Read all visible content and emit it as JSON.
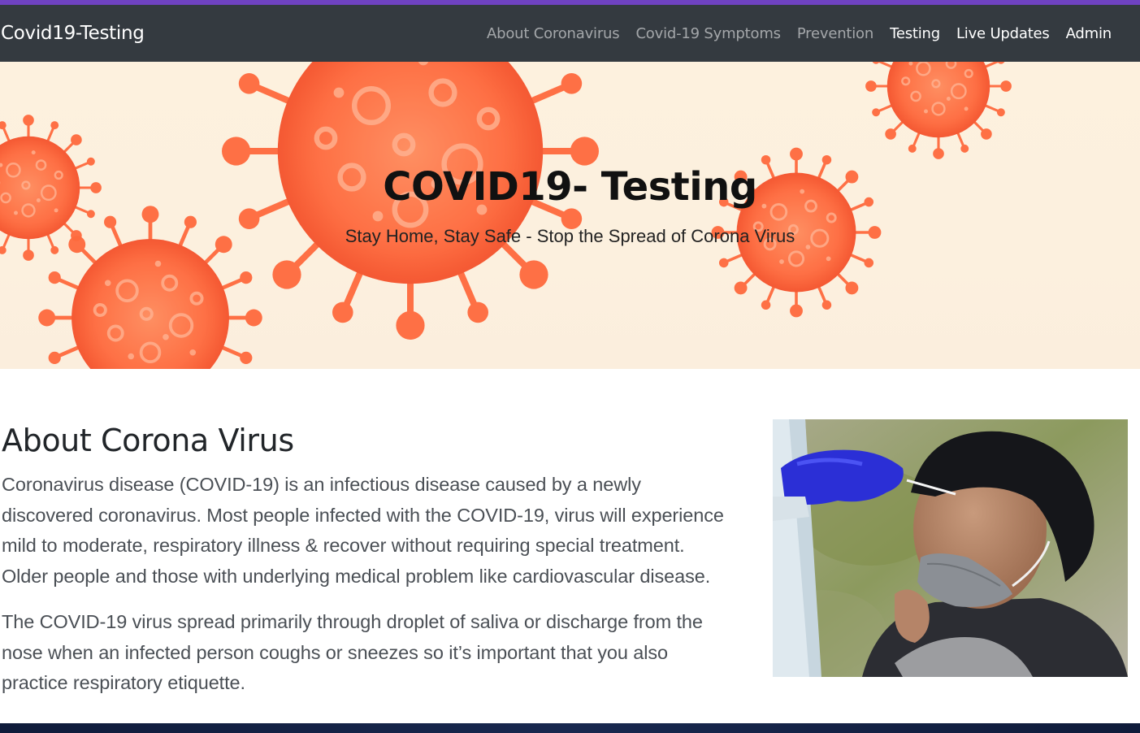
{
  "colors": {
    "top_stripe": "#6f42c1",
    "navbar_bg": "#343a40",
    "nav_inactive": "rgba(255,255,255,0.55)",
    "nav_active": "#ffffff",
    "hero_bg": "#fcf0de",
    "virus_orange": "#ff6a3d",
    "footer_bg": "#132245"
  },
  "navbar": {
    "brand": "Covid19-Testing",
    "items": [
      {
        "label": "About Coronavirus",
        "active": false
      },
      {
        "label": "Covid-19 Symptoms",
        "active": false
      },
      {
        "label": "Prevention",
        "active": false
      },
      {
        "label": "Testing",
        "active": true
      },
      {
        "label": "Live Updates",
        "active": true
      },
      {
        "label": "Admin",
        "active": true
      }
    ]
  },
  "hero": {
    "title": "COVID19- Testing",
    "subtitle": "Stay Home, Stay Safe - Stop the Spread of Corona Virus"
  },
  "about": {
    "heading": "About Corona Virus",
    "paragraphs": [
      "Coronavirus disease (COVID-19) is an infectious disease caused by a newly discovered coronavirus. Most people infected with the COVID-19, virus will experience mild to moderate, respiratory illness & recover without requiring special treatment. Older people and those with underlying medical problem like cardiovascular disease.",
      "The COVID-19 virus spread primarily through droplet of saliva or discharge from the nose when an infected person coughs or sneezes so it’s important that you also practice respiratory etiquette."
    ],
    "image_subject": "nasal-swab-test-photo"
  }
}
